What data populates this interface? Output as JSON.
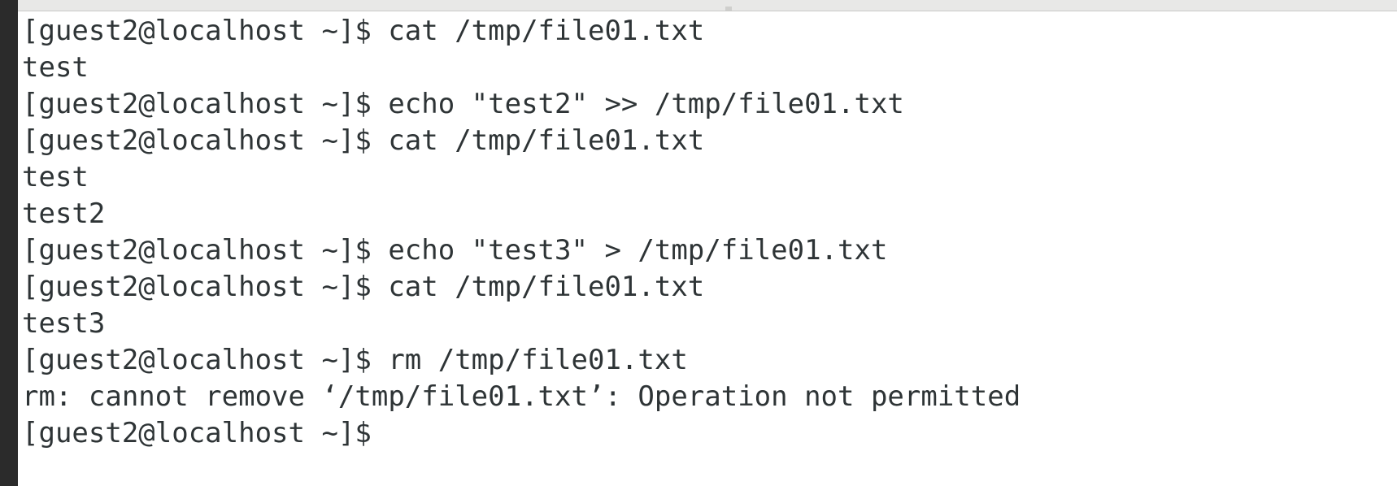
{
  "terminal": {
    "lines": [
      {
        "text": "[guest2@localhost ~]$ cat /tmp/file01.txt"
      },
      {
        "text": "test"
      },
      {
        "text": "[guest2@localhost ~]$ echo \"test2\" >> /tmp/file01.txt"
      },
      {
        "text": "[guest2@localhost ~]$ cat /tmp/file01.txt"
      },
      {
        "text": "test"
      },
      {
        "text": "test2"
      },
      {
        "text": "[guest2@localhost ~]$ echo \"test3\" > /tmp/file01.txt"
      },
      {
        "text": "[guest2@localhost ~]$ cat /tmp/file01.txt"
      },
      {
        "text": "test3"
      },
      {
        "text": "[guest2@localhost ~]$ rm /tmp/file01.txt"
      },
      {
        "text": "rm: cannot remove ‘/tmp/file01.txt’: Operation not permitted"
      },
      {
        "text": "[guest2@localhost ~]$"
      }
    ]
  }
}
